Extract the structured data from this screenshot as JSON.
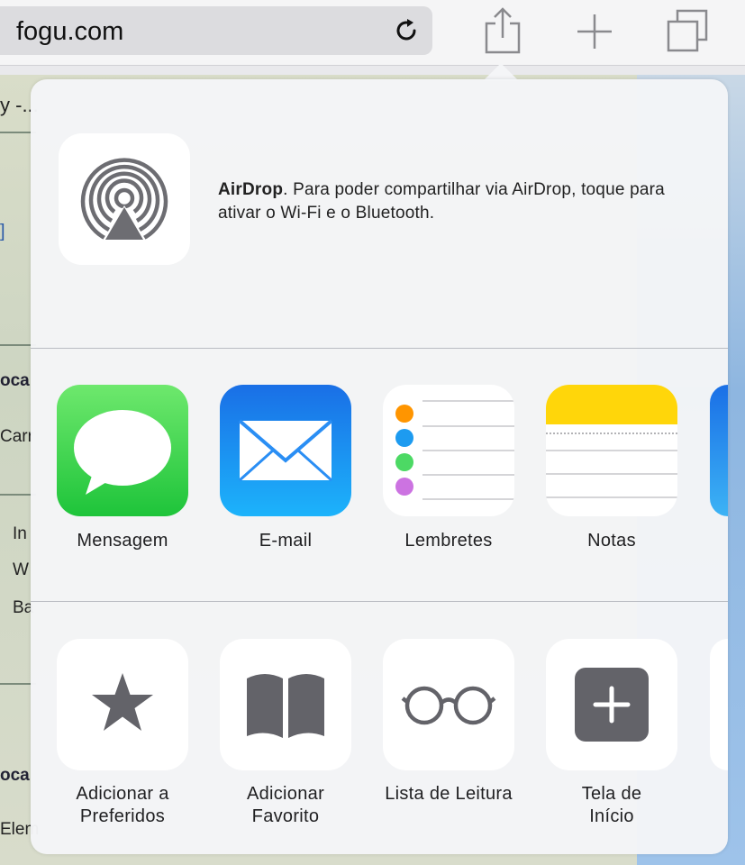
{
  "browser": {
    "url": "fogu.com"
  },
  "background": {
    "fragments": [
      "y -...",
      "]",
      "oca",
      "Carr",
      "In",
      "W",
      "Ba",
      "oca",
      "Elem"
    ]
  },
  "share_sheet": {
    "airdrop": {
      "title": "AirDrop",
      "message": ". Para poder compartilhar via AirDrop, toque para ativar o Wi-Fi e o Bluetooth."
    },
    "apps": [
      {
        "label": "Mensagem",
        "color": "#2fcc4c"
      },
      {
        "label": "E-mail",
        "color": "#1e8cf2"
      },
      {
        "label": "Lembretes",
        "color": "#ffffff"
      },
      {
        "label": "Notas",
        "color": "#ffd60a"
      }
    ],
    "actions": [
      {
        "label_line1": "Adicionar a",
        "label_line2": "Preferidos",
        "icon": "star-icon"
      },
      {
        "label_line1": "Adicionar",
        "label_line2": "Favorito",
        "icon": "book-icon"
      },
      {
        "label_line1": "Lista de Leitura",
        "label_line2": "",
        "icon": "glasses-icon"
      },
      {
        "label_line1": "Tela de",
        "label_line2": "Início",
        "icon": "plus-square-icon"
      }
    ],
    "icon_color": "#636369"
  }
}
